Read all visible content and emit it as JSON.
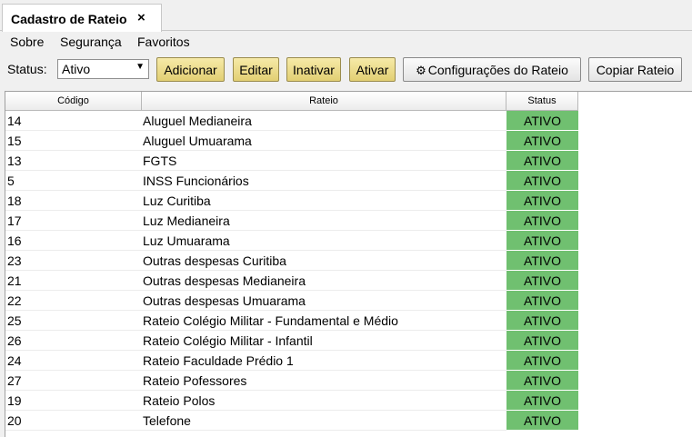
{
  "tab": {
    "title": "Cadastro de Rateio",
    "close": "×"
  },
  "menu": [
    {
      "label": "Sobre",
      "mnemonic": "o"
    },
    {
      "label": "Segurança"
    },
    {
      "label": "Favoritos"
    }
  ],
  "toolbar": {
    "status_label": "Status:",
    "status_value": "Ativo",
    "buttons": {
      "adicionar": "Adicionar",
      "editar": "Editar",
      "inativar": "Inativar",
      "ativar": "Ativar",
      "configuracoes": "Configurações do Rateio",
      "copiar": "Copiar Rateio"
    }
  },
  "table": {
    "columns": [
      "Código",
      "Rateio",
      "Status"
    ],
    "rows": [
      {
        "code": "14",
        "name": "Aluguel Medianeira",
        "status": "ATIVO"
      },
      {
        "code": "15",
        "name": "Aluguel Umuarama",
        "status": "ATIVO"
      },
      {
        "code": "13",
        "name": "FGTS",
        "status": "ATIVO"
      },
      {
        "code": "5",
        "name": "INSS Funcionários",
        "status": "ATIVO"
      },
      {
        "code": "18",
        "name": "Luz Curitiba",
        "status": "ATIVO"
      },
      {
        "code": "17",
        "name": "Luz Medianeira",
        "status": "ATIVO"
      },
      {
        "code": "16",
        "name": "Luz Umuarama",
        "status": "ATIVO"
      },
      {
        "code": "23",
        "name": "Outras despesas Curitiba",
        "status": "ATIVO"
      },
      {
        "code": "21",
        "name": "Outras despesas Medianeira",
        "status": "ATIVO"
      },
      {
        "code": "22",
        "name": "Outras despesas Umuarama",
        "status": "ATIVO"
      },
      {
        "code": "25",
        "name": "Rateio Colégio Militar - Fundamental e Médio",
        "status": "ATIVO"
      },
      {
        "code": "26",
        "name": "Rateio Colégio Militar - Infantil",
        "status": "ATIVO"
      },
      {
        "code": "24",
        "name": "Rateio Faculdade Prédio 1",
        "status": "ATIVO"
      },
      {
        "code": "27",
        "name": "Rateio Pofessores",
        "status": "ATIVO"
      },
      {
        "code": "19",
        "name": "Rateio Polos",
        "status": "ATIVO"
      },
      {
        "code": "20",
        "name": "Telefone",
        "status": "ATIVO"
      }
    ]
  },
  "colors": {
    "active_status": "#70c070",
    "yellow_button": "#e8d680"
  }
}
